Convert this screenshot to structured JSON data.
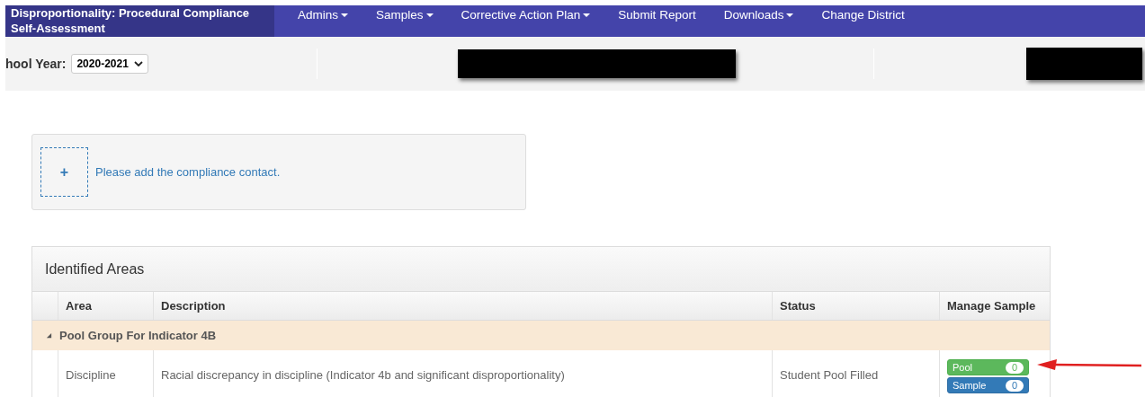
{
  "app_title": "Disproportionality: Procedural Compliance Self-Assessment",
  "nav": [
    {
      "label": "Admins",
      "dropdown": true
    },
    {
      "label": "Samples",
      "dropdown": true
    },
    {
      "label": "Corrective Action Plan",
      "dropdown": true
    },
    {
      "label": "Submit Report",
      "dropdown": false
    },
    {
      "label": "Downloads",
      "dropdown": true
    },
    {
      "label": "Change District",
      "dropdown": false
    }
  ],
  "school_year": {
    "label": "hool Year:",
    "value": "2020-2021"
  },
  "contact": {
    "add_button": "+",
    "message": "Please add the compliance contact."
  },
  "panel": {
    "title": "Identified Areas",
    "columns": [
      "Area",
      "Description",
      "Status",
      "Manage Sample"
    ],
    "groups": [
      {
        "label": "Pool Group For Indicator 4B",
        "expanded": true,
        "rows": [
          {
            "area": "Discipline",
            "description": "Racial discrepancy in discipline (Indicator 4b and significant disproportionality)",
            "status": "Student Pool Filled",
            "actions": [
              {
                "kind": "pool",
                "label": "Pool",
                "count": "0"
              },
              {
                "kind": "sample",
                "label": "Sample",
                "count": "0"
              }
            ]
          }
        ]
      }
    ]
  }
}
